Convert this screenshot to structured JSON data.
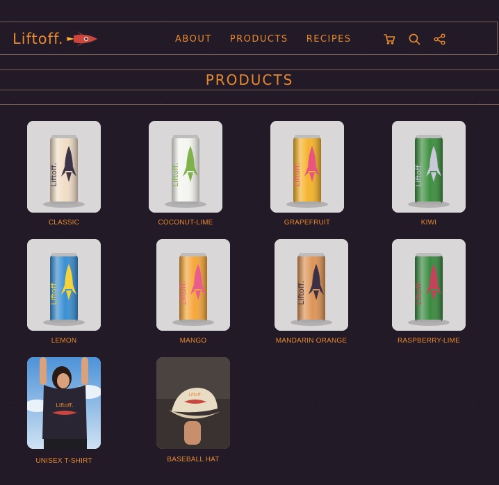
{
  "brand": {
    "name": "Liftoff.",
    "accent": "#e8892f",
    "background": "#221a27"
  },
  "nav": {
    "links": [
      "ABOUT",
      "PRODUCTS",
      "RECIPES"
    ],
    "icons": [
      "cart-icon",
      "search-icon",
      "share-icon"
    ]
  },
  "page": {
    "title": "PRODUCTS"
  },
  "products": [
    {
      "name": "CLASSIC",
      "kind": "can",
      "can_color": "#f1ddc6",
      "rocket_color": "#3d3346",
      "accent_color": "#3d3346",
      "flavor": "CLASSIC"
    },
    {
      "name": "COCONUT-LIME",
      "kind": "can",
      "can_color": "#f4f4f0",
      "rocket_color": "#7fb24b",
      "accent_color": "#7fb24b",
      "flavor": "COCONUT LIME"
    },
    {
      "name": "GRAPEFRUIT",
      "kind": "can",
      "can_color": "#f5b32c",
      "rocket_color": "#e8557d",
      "accent_color": "#e8557d",
      "flavor": "GRAPEFRUIT"
    },
    {
      "name": "KIWI",
      "kind": "can",
      "can_color": "#3d8f3f",
      "rocket_color": "#c9c9d9",
      "accent_color": "#c9c9d9",
      "flavor": "KIWI"
    },
    {
      "name": "LEMON",
      "kind": "can",
      "can_color": "#3a8fd2",
      "rocket_color": "#f5d33a",
      "accent_color": "#f5d33a",
      "flavor": "LEMON"
    },
    {
      "name": "MANGO",
      "kind": "can",
      "can_color": "#f5a63a",
      "rocket_color": "#e95d8c",
      "accent_color": "#e95d8c",
      "flavor": "MANGO"
    },
    {
      "name": "MANDARIN ORANGE",
      "kind": "can",
      "can_color": "#dd9456",
      "rocket_color": "#3b3044",
      "accent_color": "#3b3044",
      "flavor": "MANDARIN ORANGE"
    },
    {
      "name": "RASPBERRY-LIME",
      "kind": "can",
      "can_color": "#3a8a40",
      "rocket_color": "#c2435a",
      "accent_color": "#c2435a",
      "flavor": "RASPBERRY LIME"
    },
    {
      "name": "UNISEX T-SHIRT",
      "kind": "tshirt"
    },
    {
      "name": "BASEBALL HAT",
      "kind": "hat"
    }
  ]
}
